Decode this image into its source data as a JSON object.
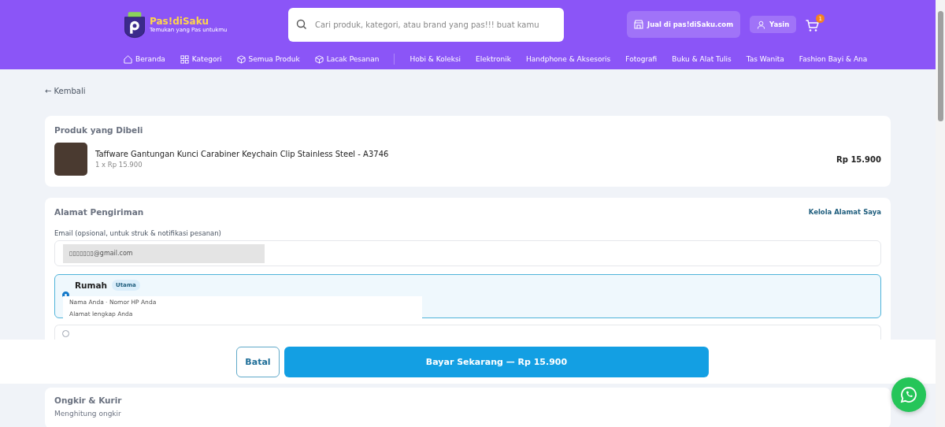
{
  "brand": {
    "name": "Pas!diSaku",
    "tagline": "Temukan yang Pas untukmu"
  },
  "search": {
    "placeholder": "Cari produk, kategori, atau brand yang pas!!! buat kamu"
  },
  "header_actions": {
    "sell": "Jual di pas!diSaku.com",
    "user": "Yasin",
    "cart_count": "1"
  },
  "nav": [
    {
      "label": "Beranda",
      "kind": "home"
    },
    {
      "label": "Kategori",
      "kind": "grid"
    },
    {
      "label": "Semua Produk",
      "kind": "box"
    },
    {
      "label": "Lacak Pesanan",
      "kind": "box"
    }
  ],
  "categories": [
    "Hobi & Koleksi",
    "Elektronik",
    "Handphone & Aksesoris",
    "Fotografi",
    "Buku & Alat Tulis",
    "Tas Wanita",
    "Fashion Bayi & Ana"
  ],
  "back_link": "← Kembali",
  "product_card": {
    "title": "Produk yang Dibeli",
    "name": "Taffware Gantungan Kunci Carabiner Keychain Clip Stainless Steel - A3746",
    "qty_price": "1 x Rp 15.900",
    "total": "Rp 15.900"
  },
  "address_card": {
    "title": "Alamat Pengiriman",
    "manage_link": "Kelola Alamat Saya",
    "email_label": "Email (opsional, untuk struk & notifikasi pesanan)",
    "email_value": "▯▯▯▯▯▯▯@gmail.com",
    "addresses": [
      {
        "label": "Rumah",
        "badge": "Utama",
        "selected": true,
        "line_1": "Nama Anda · Nomor HP Anda",
        "line_2": "Alamat lengkap Anda"
      },
      {
        "selected": false
      }
    ]
  },
  "action_bar": {
    "cancel": "Batal",
    "pay": "Bayar Sekarang — Rp 15.900"
  },
  "shipping_card": {
    "title": "Ongkir & Kurir",
    "status": "Menghitung ongkir"
  }
}
